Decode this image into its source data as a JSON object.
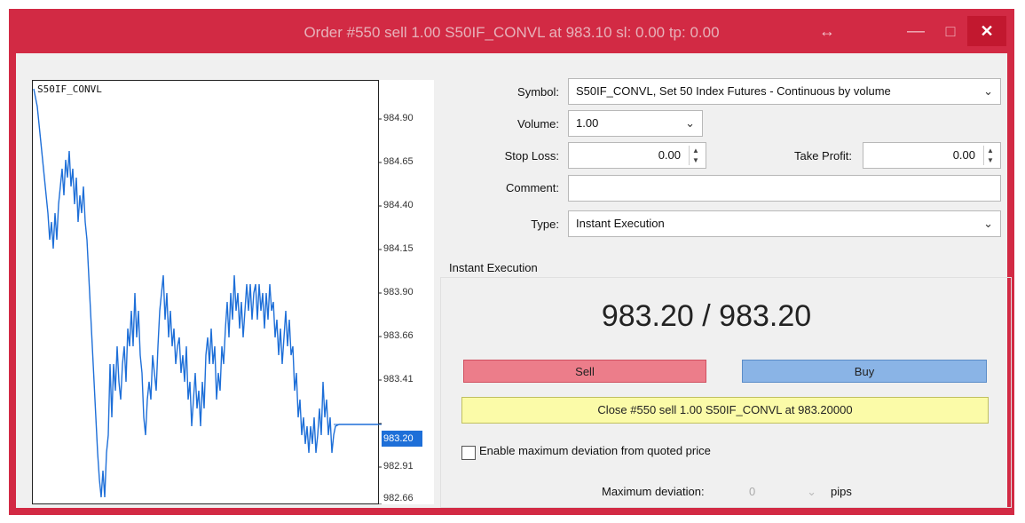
{
  "window": {
    "title": "Order #550 sell 1.00 S50IF_CONVL at 983.10 sl: 0.00 tp: 0.00",
    "controls": {
      "resize_icon": "↔",
      "minimize_icon": "—",
      "maximize_icon": "□",
      "close_icon": "✕"
    }
  },
  "chart": {
    "symbol_label": "S50IF_CONVL",
    "y_ticks": [
      "984.90",
      "984.65",
      "984.40",
      "984.15",
      "983.90",
      "983.66",
      "983.41",
      "983.20",
      "982.91",
      "982.66"
    ],
    "current_price": "983.20",
    "line_color": "#1e6fd8"
  },
  "form": {
    "symbol_label": "Symbol:",
    "symbol_value": "S50IF_CONVL, Set 50 Index Futures - Continuous  by volume",
    "volume_label": "Volume:",
    "volume_value": "1.00",
    "stop_loss_label": "Stop Loss:",
    "stop_loss_value": "0.00",
    "take_profit_label": "Take Profit:",
    "take_profit_value": "0.00",
    "comment_label": "Comment:",
    "comment_value": "",
    "type_label": "Type:",
    "type_value": "Instant Execution"
  },
  "execution": {
    "group_title": "Instant Execution",
    "prices": "983.20 / 983.20",
    "sell_label": "Sell",
    "buy_label": "Buy",
    "close_label": "Close #550 sell 1.00 S50IF_CONVL at 983.20000",
    "deviation_checkbox_label": "Enable maximum deviation from quoted price",
    "deviation_checked": false,
    "max_deviation_label": "Maximum deviation:",
    "max_deviation_value": "0",
    "pips_label": "pips"
  },
  "colors": {
    "titlebar": "#d22a44",
    "sell": "#ec7d8a",
    "buy": "#8ab4e6",
    "close_bar": "#fbfba8"
  }
}
